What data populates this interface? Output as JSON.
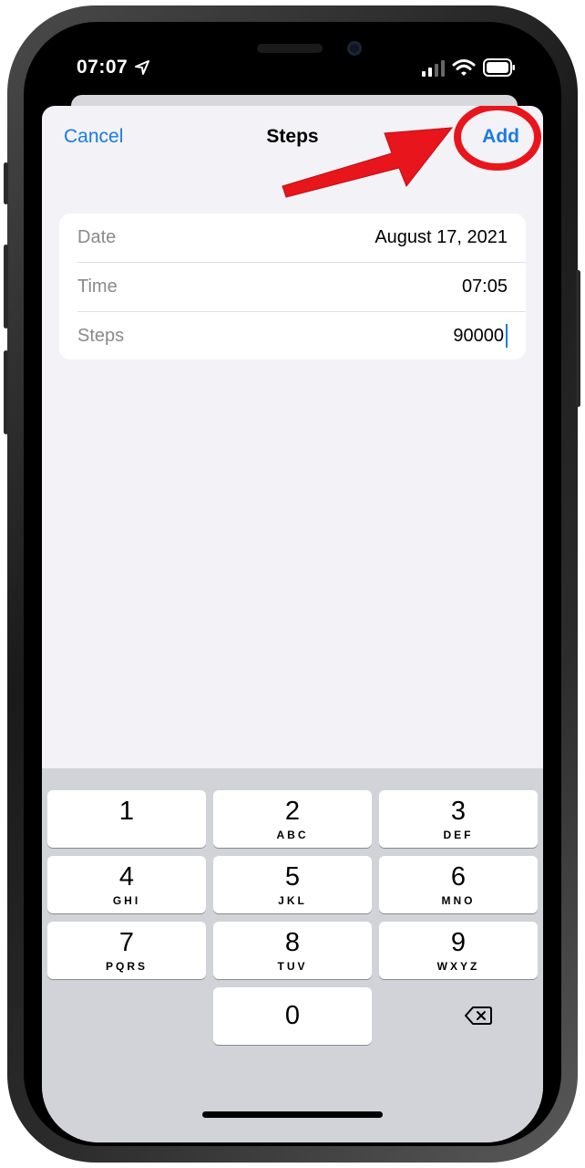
{
  "status_bar": {
    "time": "07:07"
  },
  "nav": {
    "cancel_label": "Cancel",
    "title": "Steps",
    "add_label": "Add"
  },
  "form": {
    "rows": [
      {
        "label": "Date",
        "value": "August 17, 2021"
      },
      {
        "label": "Time",
        "value": "07:05"
      },
      {
        "label": "Steps",
        "value": "90000"
      }
    ]
  },
  "keypad": {
    "keys": [
      {
        "digit": "1",
        "letters": ""
      },
      {
        "digit": "2",
        "letters": "ABC"
      },
      {
        "digit": "3",
        "letters": "DEF"
      },
      {
        "digit": "4",
        "letters": "GHI"
      },
      {
        "digit": "5",
        "letters": "JKL"
      },
      {
        "digit": "6",
        "letters": "MNO"
      },
      {
        "digit": "7",
        "letters": "PQRS"
      },
      {
        "digit": "8",
        "letters": "TUV"
      },
      {
        "digit": "9",
        "letters": "WXYZ"
      },
      {
        "digit": "0",
        "letters": ""
      }
    ],
    "delete_icon": "backspace-icon"
  },
  "colors": {
    "accent": "#1a7be0",
    "annotation": "#e8161c",
    "sheet_bg": "#f2f2f7",
    "keyboard_bg": "#d1d3d9"
  }
}
